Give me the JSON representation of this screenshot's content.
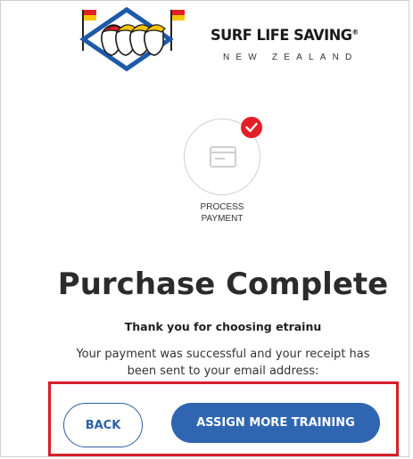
{
  "brand": {
    "name": "SURF LIFE SAVING",
    "registered_mark": "®",
    "country": "NEW ZEALAND",
    "colors": {
      "red": "#e21f26",
      "yellow": "#f5c400",
      "blue": "#1d5aa8"
    }
  },
  "progress": {
    "step_label_line1": "PROCESS",
    "step_label_line2": "PAYMENT",
    "step_icon": "payment-card-icon",
    "completed": true
  },
  "main": {
    "title": "Purchase Complete",
    "thanks": "Thank you for choosing etrainu",
    "message_line1": "Your payment was successful and your receipt has",
    "message_line2": "been sent to your email address:"
  },
  "actions": {
    "back_label": "BACK",
    "assign_label": "ASSIGN MORE TRAINING",
    "accent": "#3066b1",
    "highlight": "#d61f2a"
  }
}
